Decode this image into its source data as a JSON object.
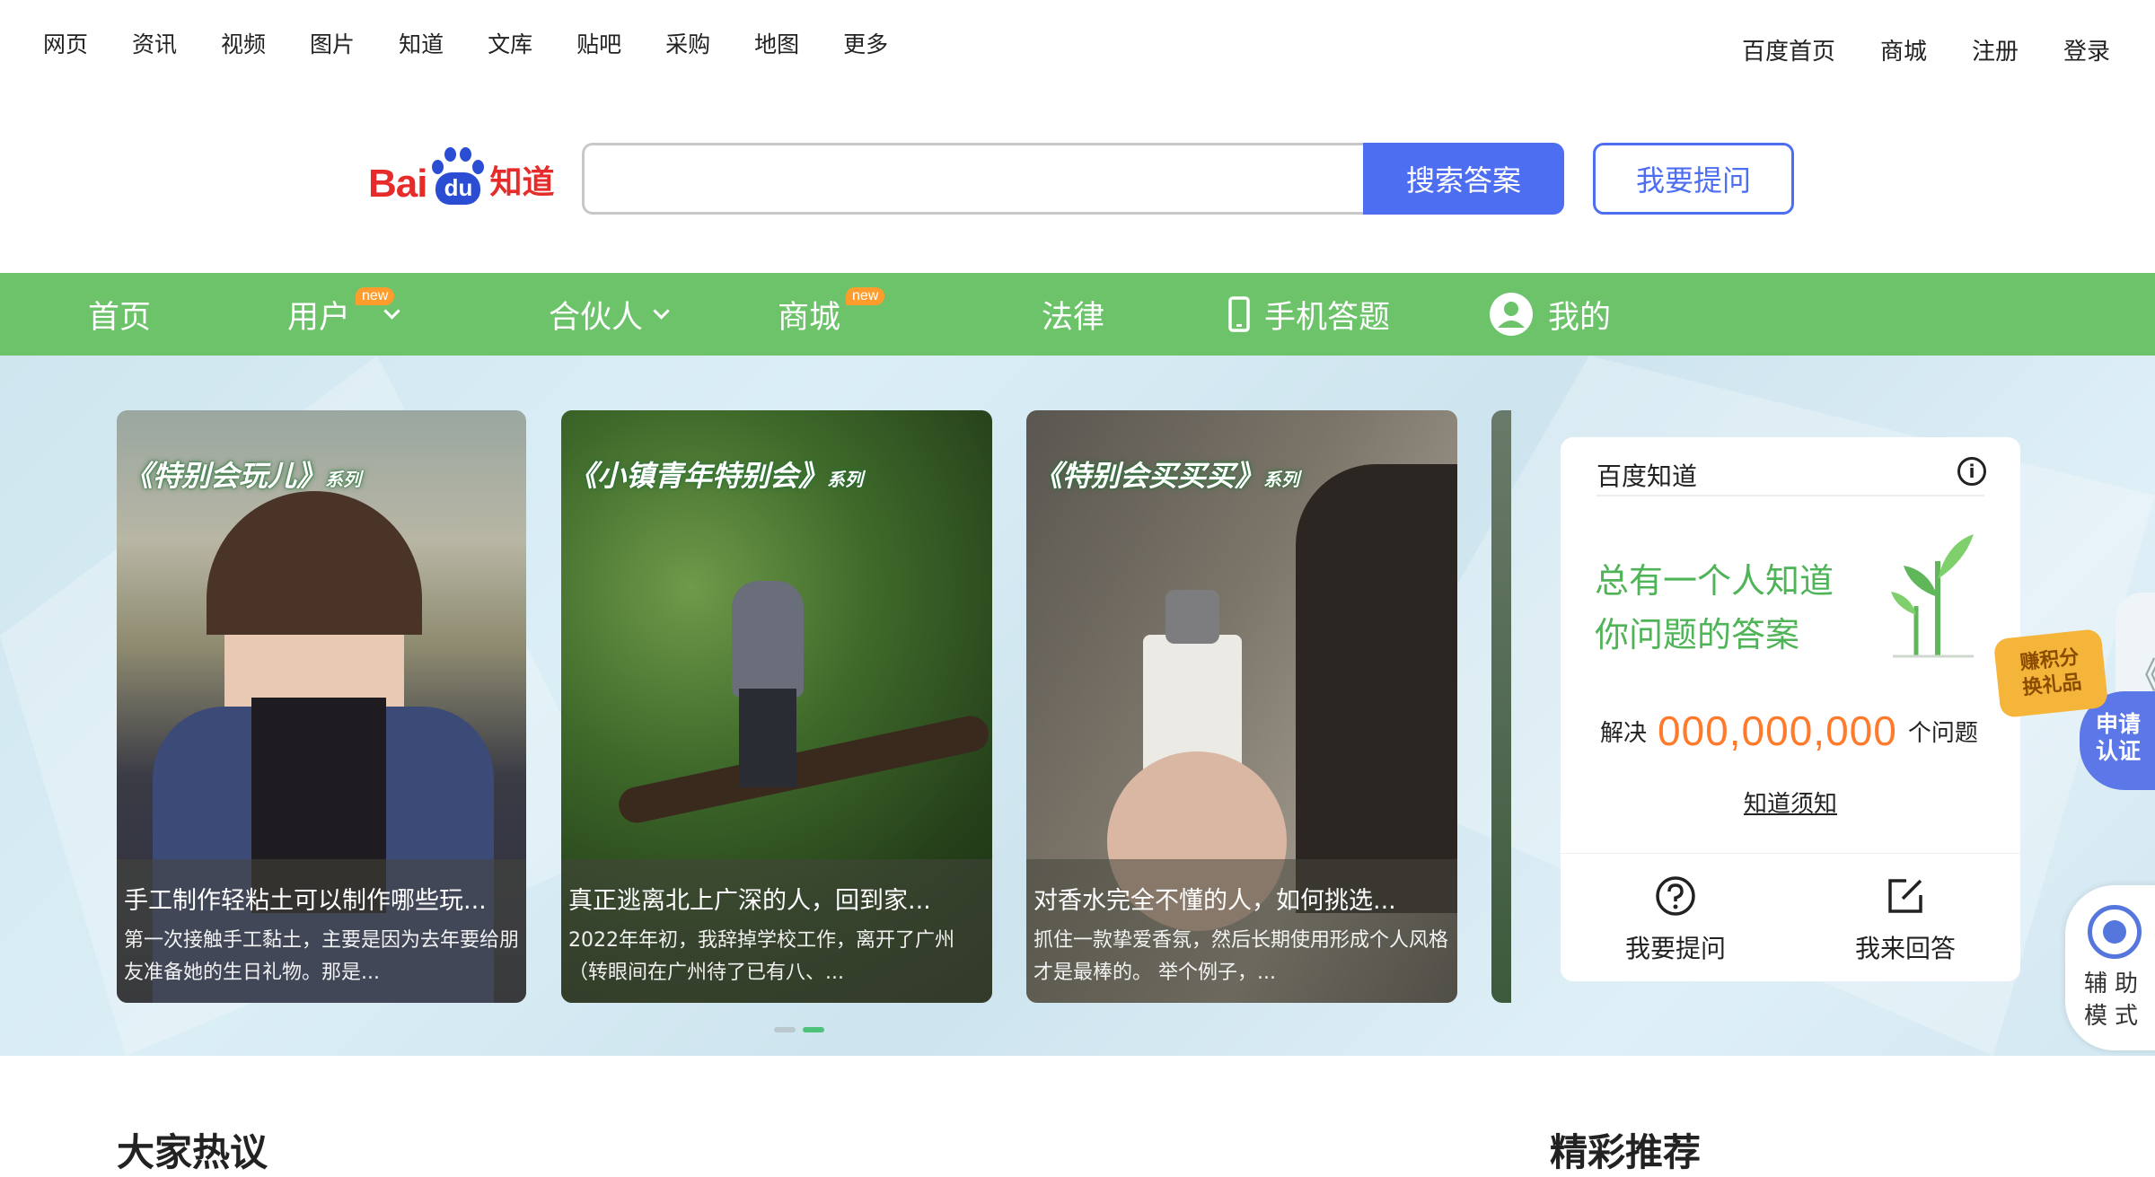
{
  "topnav": {
    "left": [
      "网页",
      "资讯",
      "视频",
      "图片",
      "知道",
      "文库",
      "贴吧",
      "采购",
      "地图",
      "更多"
    ],
    "right": [
      "百度首页",
      "商城",
      "注册",
      "登录"
    ]
  },
  "logo": {
    "bai": "Bai",
    "du": "du",
    "zhidao": "知道"
  },
  "search": {
    "placeholder": "",
    "button": "搜索答案",
    "ask_button": "我要提问"
  },
  "greenbar": {
    "home": "首页",
    "user": "用户",
    "partner": "合伙人",
    "mall": "商城",
    "law": "法律",
    "mobile": "手机答题",
    "mine": "我的",
    "new_badge": "new"
  },
  "cards": [
    {
      "series": "《特别会玩儿》",
      "series_suffix": "系列",
      "title": "手工制作轻粘土可以制作哪些玩...",
      "desc": "第一次接触手工黏土，主要是因为去年要给朋友准备她的生日礼物。那是..."
    },
    {
      "series": "《小镇青年特别会》",
      "series_suffix": "系列",
      "title": "真正逃离北上广深的人，回到家...",
      "desc": "2022年年初，我辞掉学校工作，离开了广州（转眼间在广州待了已有八、..."
    },
    {
      "series": "《特别会买买买》",
      "series_suffix": "系列",
      "title": "对香水完全不懂的人，如何挑选...",
      "desc": "抓住一款挚爱香氛，然后长期使用形成个人风格才是最棒的。 举个例子，..."
    }
  ],
  "panel": {
    "title": "百度知道",
    "info_icon": "i",
    "slogan_line1": "总有一个人知道",
    "slogan_line2": "你问题的答案",
    "solve_label": "解决",
    "solve_number": "000,000,000",
    "solve_unit": "个问题",
    "rules": "知道须知",
    "ask": "我要提问",
    "answer": "我来回答"
  },
  "widgets": {
    "points": "赚积分换礼品",
    "certify": "申请认证",
    "collapse": "《",
    "assist": "辅助模式"
  },
  "sections": {
    "hot": "大家热议",
    "recommend": "精彩推荐"
  },
  "colors": {
    "green": "#6cc36a",
    "blue": "#4e6ef2",
    "orange": "#ff7a2a",
    "slogan": "#4fb457"
  }
}
